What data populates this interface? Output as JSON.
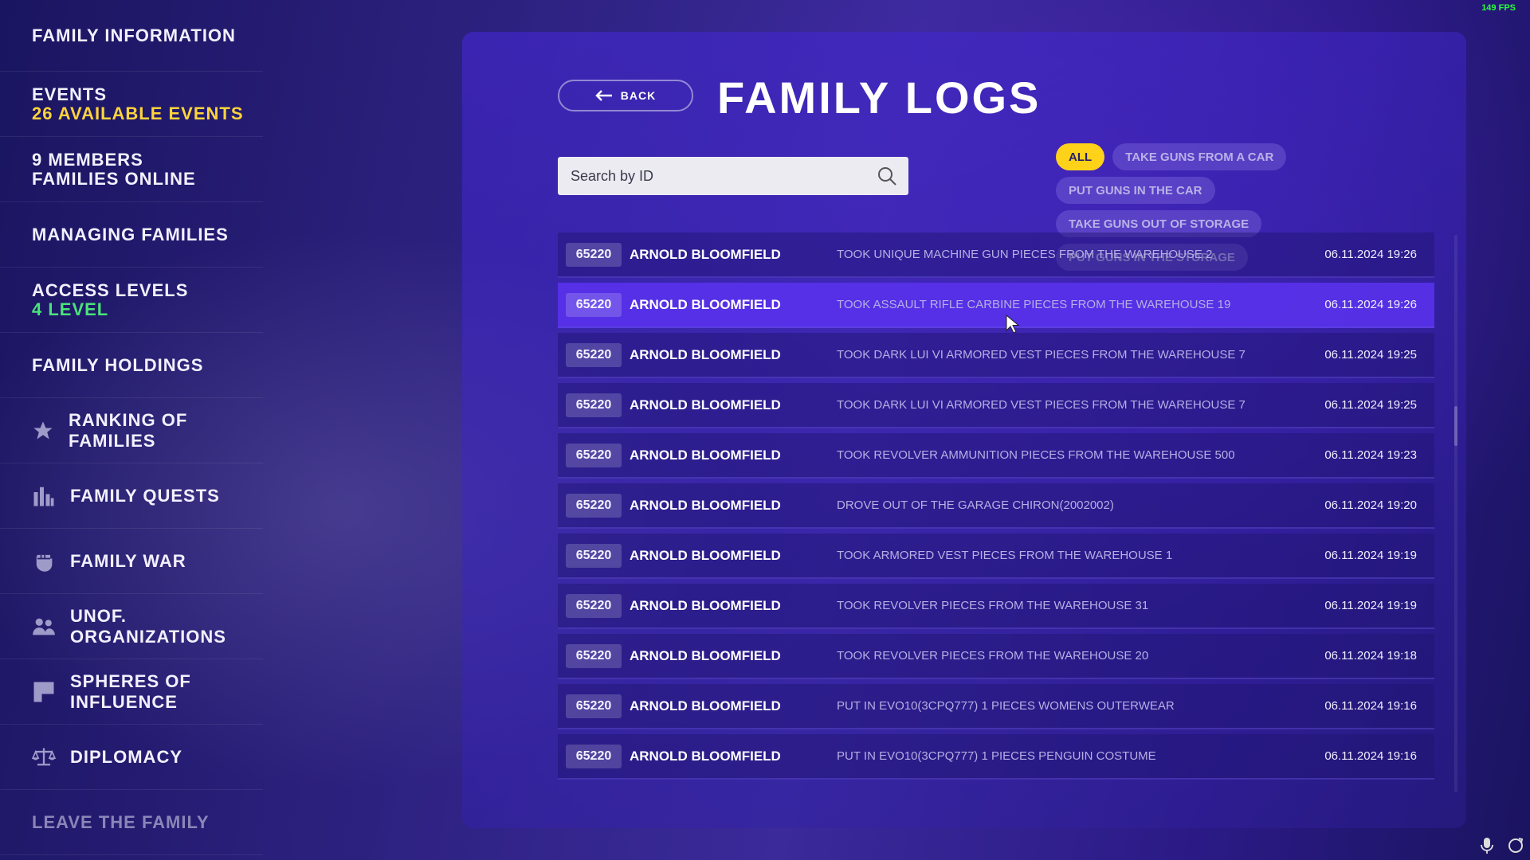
{
  "fps": "149 FPS",
  "sidebar": {
    "items": [
      {
        "label": "FAMILY INFORMATION",
        "sub": ""
      },
      {
        "label": "EVENTS",
        "sub": "26 AVAILABLE EVENTS"
      },
      {
        "label": "9 MEMBERS",
        "sub": "FAMILIES ONLINE"
      },
      {
        "label": "MANAGING FAMILIES",
        "sub": ""
      },
      {
        "label": "ACCESS LEVELS",
        "sub": "4 LEVEL"
      },
      {
        "label": "FAMILY HOLDINGS",
        "sub": ""
      },
      {
        "label": "RANKING OF FAMILIES",
        "icon": "star-icon"
      },
      {
        "label": "FAMILY QUESTS",
        "icon": "bar-chart-icon"
      },
      {
        "label": "FAMILY WAR",
        "icon": "fist-icon"
      },
      {
        "label": "UNOF. ORGANIZATIONS",
        "icon": "people-icon"
      },
      {
        "label": "SPHERES OF INFLUENCE",
        "icon": "flag-icon"
      },
      {
        "label": "DIPLOMACY",
        "icon": "scales-icon"
      },
      {
        "label": "LEAVE THE FAMILY",
        "sub": ""
      }
    ]
  },
  "header": {
    "back_label": "BACK",
    "title": "FAMILY LOGS"
  },
  "search": {
    "placeholder": "Search by ID",
    "value": ""
  },
  "filters": [
    {
      "label": "ALL",
      "active": true
    },
    {
      "label": "TAKE GUNS FROM A CAR",
      "active": false
    },
    {
      "label": "PUT GUNS IN THE CAR",
      "active": false
    },
    {
      "label": "TAKE GUNS OUT OF STORAGE",
      "active": false
    },
    {
      "label": "PUT GUNS IN THE STORAGE",
      "active": false
    }
  ],
  "logs": [
    {
      "id": "65220",
      "name": "ARNOLD BLOOMFIELD",
      "action": "TOOK UNIQUE MACHINE GUN PIECES FROM THE WAREHOUSE 2",
      "date": "06.11.2024 19:26"
    },
    {
      "id": "65220",
      "name": "ARNOLD BLOOMFIELD",
      "action": "TOOK ASSAULT RIFLE CARBINE PIECES FROM THE WAREHOUSE 19",
      "date": "06.11.2024 19:26"
    },
    {
      "id": "65220",
      "name": "ARNOLD BLOOMFIELD",
      "action": "TOOK DARK LUI VI ARMORED VEST PIECES FROM THE WAREHOUSE 7",
      "date": "06.11.2024 19:25"
    },
    {
      "id": "65220",
      "name": "ARNOLD BLOOMFIELD",
      "action": "TOOK DARK LUI VI ARMORED VEST PIECES FROM THE WAREHOUSE 7",
      "date": "06.11.2024 19:25"
    },
    {
      "id": "65220",
      "name": "ARNOLD BLOOMFIELD",
      "action": "TOOK REVOLVER AMMUNITION PIECES FROM THE WAREHOUSE 500",
      "date": "06.11.2024 19:23"
    },
    {
      "id": "65220",
      "name": "ARNOLD BLOOMFIELD",
      "action": "DROVE OUT OF THE GARAGE CHIRON(2002002)",
      "date": "06.11.2024 19:20"
    },
    {
      "id": "65220",
      "name": "ARNOLD BLOOMFIELD",
      "action": "TOOK ARMORED VEST PIECES FROM THE WAREHOUSE 1",
      "date": "06.11.2024 19:19"
    },
    {
      "id": "65220",
      "name": "ARNOLD BLOOMFIELD",
      "action": "TOOK REVOLVER PIECES FROM THE WAREHOUSE 31",
      "date": "06.11.2024 19:19"
    },
    {
      "id": "65220",
      "name": "ARNOLD BLOOMFIELD",
      "action": "TOOK REVOLVER PIECES FROM THE WAREHOUSE 20",
      "date": "06.11.2024 19:18"
    },
    {
      "id": "65220",
      "name": "ARNOLD BLOOMFIELD",
      "action": "PUT IN EVO10(3CPQ777) 1 PIECES WOMENS OUTERWEAR",
      "date": "06.11.2024 19:16"
    },
    {
      "id": "65220",
      "name": "ARNOLD BLOOMFIELD",
      "action": "PUT IN EVO10(3CPQ777) 1 PIECES PENGUIN COSTUME",
      "date": "06.11.2024 19:16"
    }
  ],
  "colors": {
    "accent_yellow": "#ffd21a",
    "sub_yellow": "#ffd43b",
    "sub_green": "#4be37a",
    "highlight_row": "#5a32f0",
    "fps_green": "#28ff3a"
  }
}
